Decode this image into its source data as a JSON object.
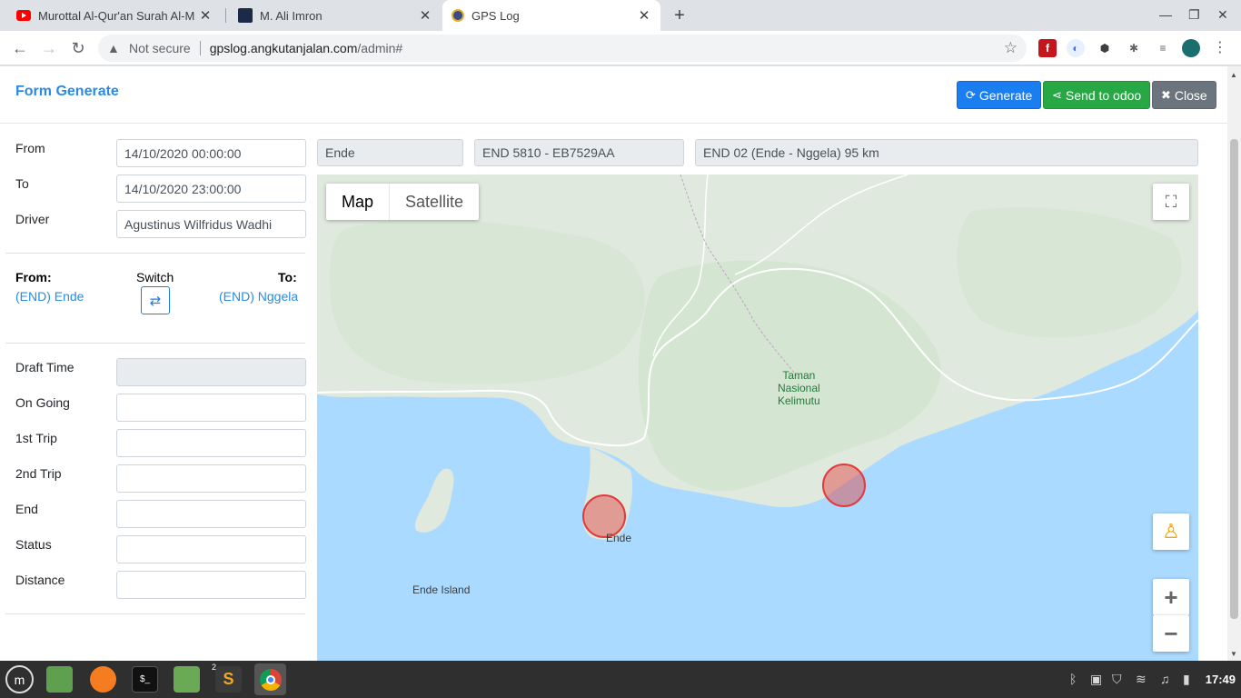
{
  "browser": {
    "tabs": [
      {
        "title": "Murottal Al-Qur'an Surah Al-M",
        "icon": "youtube-icon"
      },
      {
        "title": "M. Ali Imron",
        "icon": "site-icon"
      },
      {
        "title": "GPS Log",
        "icon": "globe-icon"
      }
    ],
    "security_label": "Not secure",
    "url_host": "gpslog.angkutanjalan.com",
    "url_path": "/admin#"
  },
  "modal": {
    "title": "Form Generate",
    "buttons": {
      "generate": "Generate",
      "send": "Send to odoo",
      "close": "Close"
    }
  },
  "form": {
    "from_label": "From",
    "from_value": "14/10/2020 00:00:00",
    "to_label": "To",
    "to_value": "14/10/2020 23:00:00",
    "driver_label": "Driver",
    "driver_value": "Agustinus Wilfridus Wadhi"
  },
  "route": {
    "from_label": "From:",
    "from_value": "(END) Ende",
    "switch_label": "Switch",
    "to_label": "To:",
    "to_value": "(END) Nggela"
  },
  "status_fields": [
    {
      "label": "Draft Time",
      "value": "",
      "disabled": true
    },
    {
      "label": "On Going",
      "value": ""
    },
    {
      "label": "1st Trip",
      "value": ""
    },
    {
      "label": "2nd Trip",
      "value": ""
    },
    {
      "label": "End",
      "value": ""
    },
    {
      "label": "Status",
      "value": ""
    },
    {
      "label": "Distance",
      "value": ""
    }
  ],
  "info": {
    "city": "Ende",
    "vehicle": "END 5810 - EB7529AA",
    "route": "END 02 (Ende - Nggela) 95 km"
  },
  "map": {
    "type_map": "Map",
    "type_satellite": "Satellite",
    "labels": {
      "park": "Taman\nNasional\nKelimutu",
      "city": "Ende",
      "island": "Ende Island"
    },
    "colors": {
      "sea": "#aadaff",
      "land": "#dfe9dd",
      "marker": "#e33b3b"
    }
  },
  "taskbar": {
    "clock": "17:49",
    "badge": "2"
  }
}
